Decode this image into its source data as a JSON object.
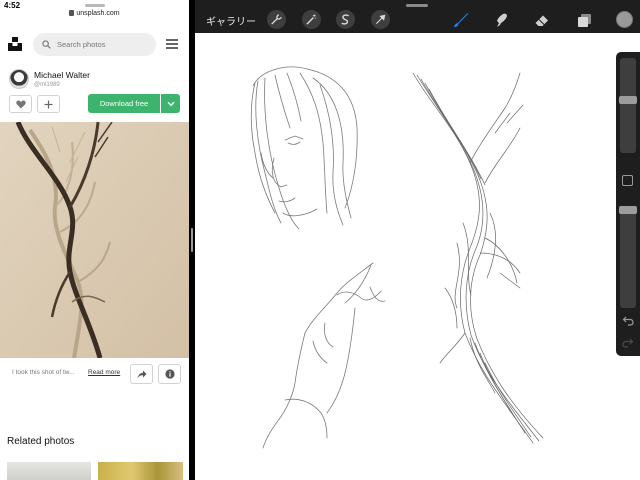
{
  "status": {
    "time": "4:52"
  },
  "browser": {
    "url": "unsplash.com"
  },
  "unsplash": {
    "search_placeholder": "Search photos",
    "author": {
      "name": "Michael Walter",
      "handle": "@ml1989"
    },
    "download_label": "Download free",
    "caption": "I took this shot of tw...",
    "read_more": "Read more",
    "related_heading": "Related photos",
    "accent_color": "#3cb46e"
  },
  "procreate": {
    "gallery_label": "ギャラリー",
    "tools": [
      "wrench-icon",
      "magic-wand-icon",
      "selection-icon",
      "transform-icon",
      "brush-icon",
      "smudge-icon",
      "eraser-icon",
      "layers-icon",
      "color-icon"
    ],
    "active_tool": "brush",
    "active_tool_color": "#1f7ff0",
    "current_color": "#9a9a9a"
  }
}
